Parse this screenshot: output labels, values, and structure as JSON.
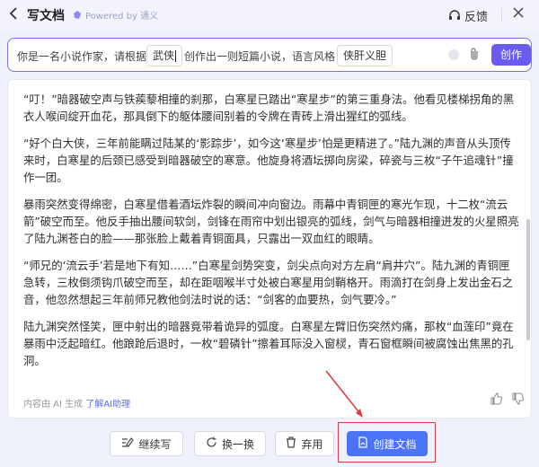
{
  "header": {
    "title": "写文档",
    "powered_by": "Powered by 通义",
    "feedback": "反馈"
  },
  "prompt": {
    "part1": "你是一名小说作家，请根据",
    "slot1": "武侠",
    "part2": "创作出一则短篇小说，语言风格",
    "slot2": "侠肝义胆",
    "create_label": "创作"
  },
  "content": {
    "paragraphs": [
      "“叮！”暗器破空声与铁蒺藜相撞的刹那，白寒星已踏出“寒星步”的第三重身法。他看见楼梯拐角的黑衣人喉间绽开血花，那具倒下的躯体腰间别着的令牌在青砖上滑出猩红的弧线。",
      "“好个白大侠，三年前能瞒过陆某的‘影踪步’，如今这‘寒星步’怕是更精进了。”陆九渊的声音从头顶传来时，白寒星的后颈已感受到暗器破空的寒意。他旋身将酒坛掷向房梁，碎瓷与三枚“子午追魂针”撞作一团。",
      "暴雨突然变得绵密，白寒星借着酒坛炸裂的瞬间冲向窗边。雨幕中青铜匣的寒光乍现，十二枚“流云箭”破空而至。他反手抽出腰间软剑，剑锋在雨帘中划出银亮的弧线，剑气与暗器相撞迸发的火星照亮了陆九渊苍白的脸——那张脸上戴着青铜面具，只露出一双血红的眼睛。",
      "“师兄的‘流云手’若是地下有知……”白寒星剑势突变，剑尖点向对方左肩“肩井穴”。陆九渊的青铜匣急转，三枚倒须钩爪破空而至，却在距咽喉半寸处被白寒星用剑鞘格开。雨滴打在剑身上发出金石之音，他忽然想起三年前师兄教他剑法时说的话：“剑客的血要热，剑气要冷。”",
      "陆九渊突然怪笑，匣中射出的暗器竟带着诡异的弧度。白寒星左臂旧伤突然灼痛，那枚“血莲印”竟在暴雨中泛起暗红。他踉跄后退时，一枚“碧磷针”擦着耳际没入窗棂，青石窗框瞬间被腐蚀出焦黑的孔洞。"
    ]
  },
  "footer": {
    "note": "内容由 AI 生成",
    "link": "了解AI助理"
  },
  "actions": {
    "continue": "继续写",
    "swap": "换一换",
    "discard": "弃用",
    "create_doc": "创建文档"
  },
  "colors": {
    "accent": "#6a5cf0",
    "primary_button": "#4a73f5",
    "highlight": "#e13a3a"
  }
}
